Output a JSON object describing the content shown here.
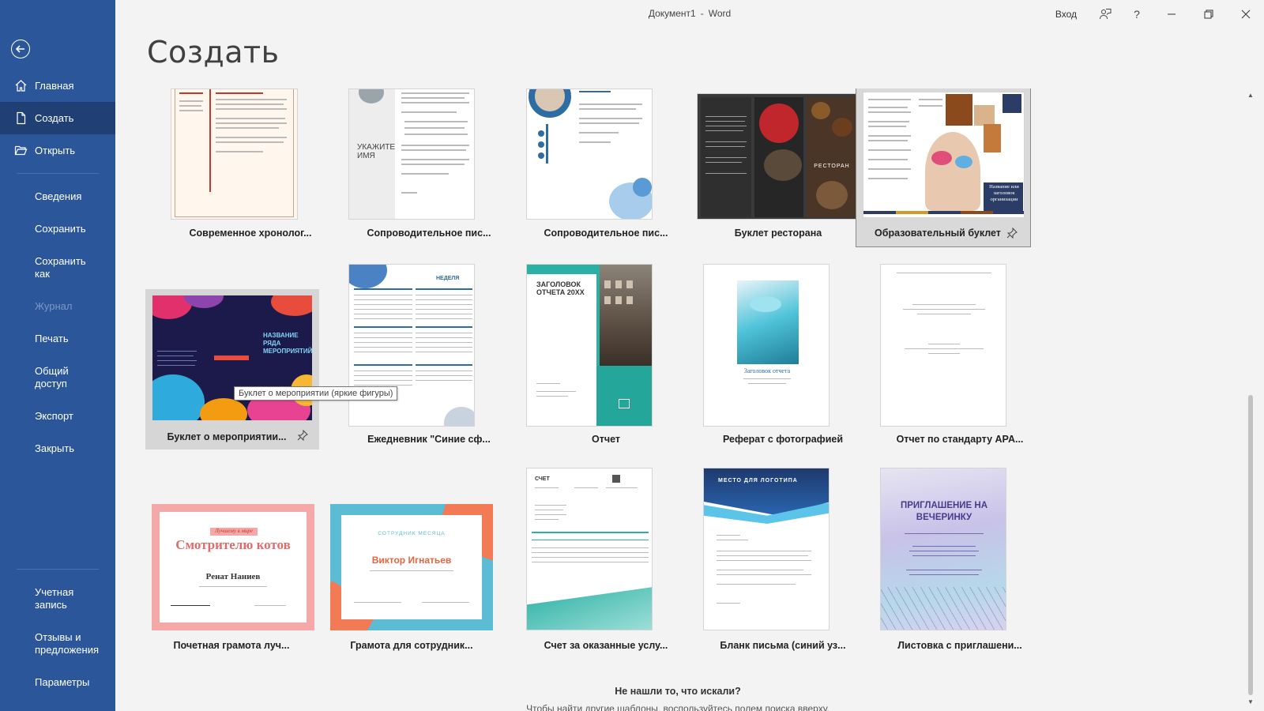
{
  "window": {
    "title_doc": "Документ1",
    "title_sep": "-",
    "title_app": "Word",
    "signin_label": "Вход"
  },
  "sidebar": {
    "main_items": [
      {
        "label": "Главная",
        "icon": "home-icon"
      },
      {
        "label": "Создать",
        "icon": "new-document-icon"
      },
      {
        "label": "Открыть",
        "icon": "open-folder-icon"
      }
    ],
    "items": [
      {
        "label": "Сведения"
      },
      {
        "label": "Сохранить"
      },
      {
        "label": "Сохранить как"
      },
      {
        "label": "Журнал"
      },
      {
        "label": "Печать"
      },
      {
        "label": "Общий доступ"
      },
      {
        "label": "Экспорт"
      },
      {
        "label": "Закрыть"
      }
    ],
    "bottom_items": [
      {
        "label": "Учетная запись"
      },
      {
        "label": "Отзывы и предложения"
      },
      {
        "label": "Параметры"
      }
    ],
    "active_item": "Создать",
    "disabled_item": "Журнал"
  },
  "page": {
    "title": "Создать"
  },
  "templates": [
    {
      "label": "Современное хронолог..."
    },
    {
      "label": "Сопроводительное пис..."
    },
    {
      "label": "Сопроводительное пис..."
    },
    {
      "label": "Буклет ресторана"
    },
    {
      "label": "Образовательный буклет"
    },
    {
      "label": "Буклет о мероприятии..."
    },
    {
      "label": "Ежедневник \"Синие сф..."
    },
    {
      "label": "Отчет"
    },
    {
      "label": "Реферат с фотографией"
    },
    {
      "label": "Отчет по стандарту APA..."
    },
    {
      "label": "Почетная грамота луч..."
    },
    {
      "label": "Грамота для сотрудник..."
    },
    {
      "label": "Счет за оказанные услу..."
    },
    {
      "label": "Бланк письма (синий уз..."
    },
    {
      "label": "Листовка с приглашени..."
    }
  ],
  "thumb_text": {
    "cover_letter": "УКАЖИТЕ ИМЯ",
    "event_title": "НАЗВАНИЕ РЯДА МЕРОПРИЯТИЙ",
    "planner_head": "НЕДЕЛЯ",
    "report_title": "ЗАГОЛОВОК ОТЧЕТА 20XX",
    "photo_report_title": "Заголовок отчета",
    "certificate_sub": "Лучшему в мире",
    "certificate_title": "Смотрителю котов",
    "certificate_name": "Ренат Наниев",
    "employee_sub": "СОТРУДНИК МЕСЯЦА",
    "employee_name": "Виктор Игнатьев",
    "invoice_head": "СЧЕТ",
    "letterhead_head": "МЕСТО ДЛЯ ЛОГОТИПА",
    "invitation_title": "ПРИГЛАШЕНИЕ НА ВЕЧЕРИНКУ",
    "edu_booklet_title": "Название или заголовок организации",
    "restaurant_name": "РЕСТОРАН"
  },
  "tooltip": "Буклет о мероприятии (яркие фигуры)",
  "footer": {
    "not_found": "Не нашли то, что искали?",
    "hint": "Чтобы найти другие шаблоны, воспользуйтесь полем поиска вверху."
  },
  "colors": {
    "sidebar": "#2b579a",
    "sidebar_active": "#1f3f75",
    "background": "#f3f3f3"
  }
}
